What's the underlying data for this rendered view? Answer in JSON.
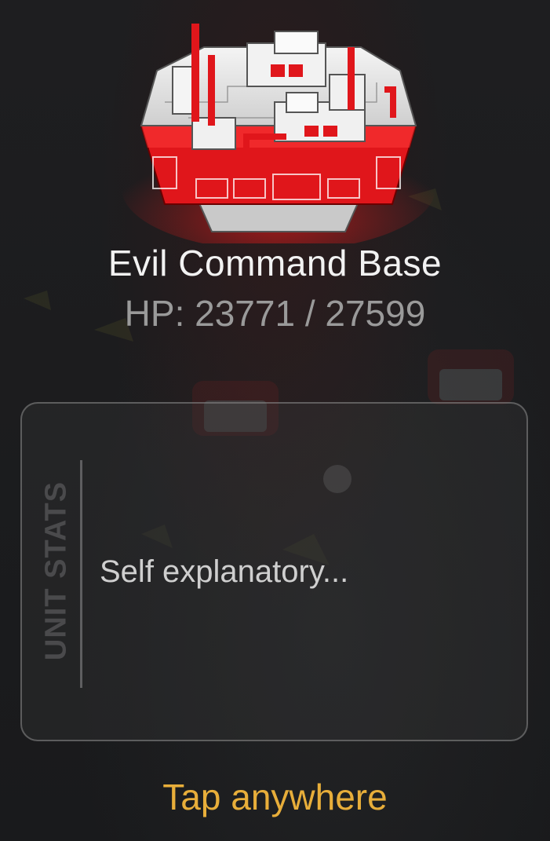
{
  "unit": {
    "name": "Evil Command Base",
    "hp_label": "HP: 23771 / 27599",
    "hp_current": 23771,
    "hp_max": 27599,
    "image_icon": "command-base-icon"
  },
  "stats": {
    "tab_label": "UNIT STATS",
    "description": "Self explanatory..."
  },
  "footer": {
    "tap_hint": "Tap anywhere"
  },
  "colors": {
    "accent_red": "#e0161b",
    "hint_gold": "#e8ae3a",
    "name_text": "#f2f2f2",
    "hp_text": "#9a9a9a"
  }
}
